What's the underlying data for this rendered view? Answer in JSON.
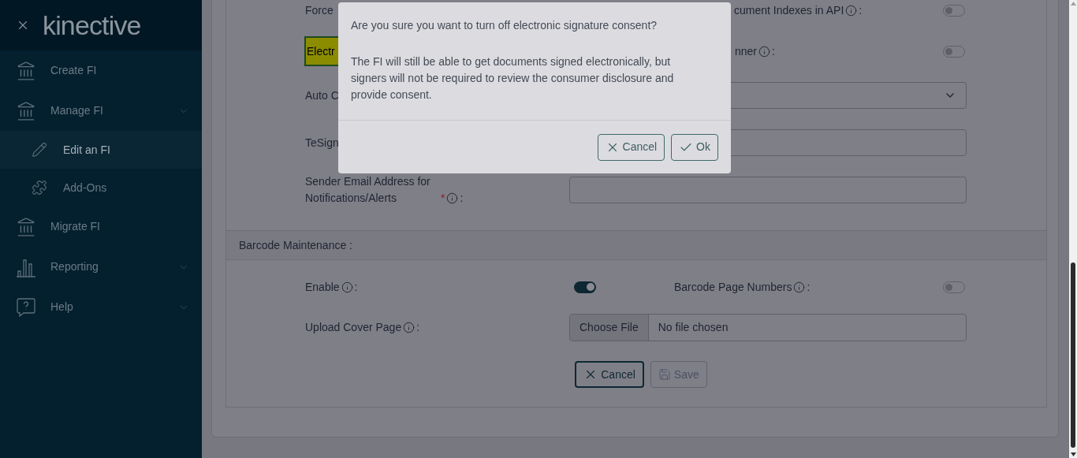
{
  "sidebar": {
    "logo": "kinective",
    "items": [
      {
        "label": "Create FI",
        "kind": "link"
      },
      {
        "label": "Manage FI",
        "kind": "menu",
        "children": [
          {
            "label": "Edit an FI",
            "selected": true
          },
          {
            "label": "Add-Ons",
            "selected": false
          }
        ]
      },
      {
        "label": "Migrate FI",
        "kind": "link"
      },
      {
        "label": "Reporting",
        "kind": "menu"
      },
      {
        "label": "Help",
        "kind": "menu"
      }
    ]
  },
  "form": {
    "rows": [
      {
        "kind": "toggle_pair",
        "fields": [
          {
            "label": "Force",
            "highlighted": false
          },
          {
            "label": "cument Indexes in API",
            "suffix": ":",
            "on": false,
            "highlighted": false
          }
        ]
      },
      {
        "kind": "toggle_pair",
        "fields": [
          {
            "label": "Electr",
            "highlighted": true
          },
          {
            "label": "nner",
            "suffix": ":",
            "on": false,
            "highlighted": false
          }
        ]
      },
      {
        "kind": "select",
        "label": "Auto C"
      },
      {
        "kind": "text",
        "label": "TeSign"
      },
      {
        "kind": "text",
        "label": "Sender Email Address for Notifications/Alerts",
        "required_mark": "*",
        "suffix": ":"
      }
    ],
    "sections": [
      {
        "title": "Barcode Maintenance :",
        "rows": [
          {
            "kind": "toggle_pair",
            "fields": [
              {
                "label": "Enable",
                "suffix": ":",
                "on": true,
                "highlighted": false
              },
              {
                "label": "Barcode Page Numbers",
                "suffix": ":",
                "on": false,
                "highlighted": false
              }
            ]
          },
          {
            "kind": "file",
            "label": "Upload Cover Page",
            "suffix": ":",
            "button": "Choose File",
            "value": "No file chosen"
          }
        ]
      }
    ],
    "buttons": [
      {
        "label": "Cancel",
        "kind": "cancel",
        "disabled": false
      },
      {
        "label": "Save",
        "kind": "save",
        "disabled": true
      }
    ]
  },
  "dialog": {
    "question": "Are you sure you want to turn off electronic signature consent?",
    "message": "The FI will still be able to get documents signed electronically, but signers will not be required to review the consumer disclosure and provide consent.",
    "buttons": [
      {
        "label": "Cancel",
        "kind": "cancel"
      },
      {
        "label": "Ok",
        "kind": "ok"
      }
    ]
  }
}
